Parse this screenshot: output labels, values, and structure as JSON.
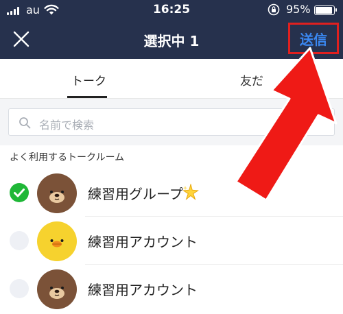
{
  "status_bar": {
    "carrier": "au",
    "time": "16:25",
    "battery_percent": "95%",
    "battery_level": 0.95
  },
  "nav": {
    "close_icon": "close-icon",
    "title": "選択中 1",
    "send_label": "送信"
  },
  "tabs": {
    "talk": "トーク",
    "friends": "友だ"
  },
  "search": {
    "placeholder": "名前で検索"
  },
  "section_title": "よく利用するトークルーム",
  "rooms": [
    {
      "label": "練習用グループ",
      "selected": true,
      "avatar": "brown-bear-avatar",
      "badge": "sparkle-icon"
    },
    {
      "label": "練習用アカウント",
      "selected": false,
      "avatar": "sally-chick-avatar"
    },
    {
      "label": "練習用アカウント",
      "selected": false,
      "avatar": "brown-bear-avatar"
    }
  ],
  "colors": {
    "header_bg": "#26314d",
    "send_text": "#3a87f0",
    "highlight": "#e0201f",
    "check_on": "#1fb737"
  }
}
